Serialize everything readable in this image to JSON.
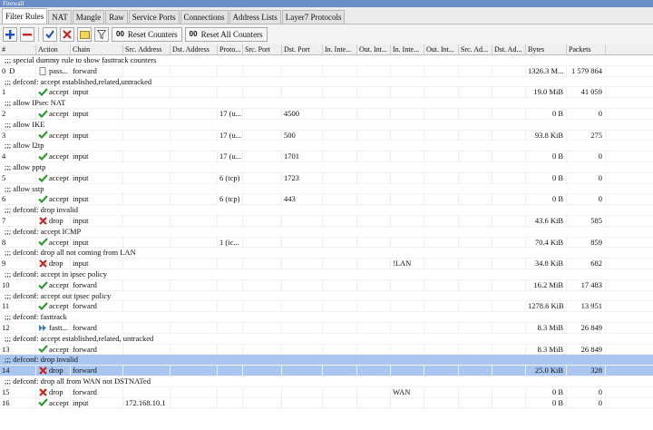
{
  "window": {
    "title": "Firewall"
  },
  "tabs": [
    "Filter Rules",
    "NAT",
    "Mangle",
    "Raw",
    "Service Ports",
    "Connections",
    "Address Lists",
    "Layer7 Protocols"
  ],
  "toolbar": {
    "add_icon": "plus-icon",
    "remove_icon": "minus-icon",
    "enable_icon": "check-icon",
    "disable_icon": "x-icon",
    "comment_icon": "note-icon",
    "filter_icon": "filter-icon",
    "reset_counters": "Reset Counters",
    "reset_all_counters": "Reset All Counters",
    "counter_glyph": "00"
  },
  "columns": [
    "#",
    "Action",
    "Chain",
    "Src. Address",
    "Dst. Address",
    "Proto...",
    "Src. Port",
    "Dst. Port",
    "In. Inte...",
    "Out. Int...",
    "In. Inte...",
    "Out. Int...",
    "Src. Ad...",
    "Dst. Ad...",
    "Bytes",
    "Packets"
  ],
  "colors": {
    "accept": "#2f9a2f",
    "drop": "#cc2222",
    "selected": "#a9c6f0",
    "passthrough": "#3a80c8"
  },
  "rules": [
    {
      "comment": ";;; special dummy rule to show fasttrack counters",
      "num": "0",
      "flag": "D",
      "action": "pass...",
      "action_type": "passthrough",
      "chain": "forward",
      "src": "",
      "dst": "",
      "proto": "",
      "sport": "",
      "dport": "",
      "inif": "",
      "outif": "",
      "inifl": "",
      "outifl": "",
      "srcal": "",
      "dstal": "",
      "bytes": "1326.3 M...",
      "packets": "1 579 864",
      "selected": false
    },
    {
      "comment": ";;; defconf: accept established,related,untracked",
      "num": "1",
      "flag": "",
      "action": "accept",
      "action_type": "accept",
      "chain": "input",
      "src": "",
      "dst": "",
      "proto": "",
      "sport": "",
      "dport": "",
      "inif": "",
      "outif": "",
      "inifl": "",
      "outifl": "",
      "srcal": "",
      "dstal": "",
      "bytes": "19.0 MiB",
      "packets": "41 059",
      "selected": false
    },
    {
      "comment": ";;; allow IPsec NAT",
      "num": "2",
      "flag": "",
      "action": "accept",
      "action_type": "accept",
      "chain": "input",
      "src": "",
      "dst": "",
      "proto": "17 (u...",
      "sport": "",
      "dport": "4500",
      "inif": "",
      "outif": "",
      "inifl": "",
      "outifl": "",
      "srcal": "",
      "dstal": "",
      "bytes": "0 B",
      "packets": "0",
      "selected": false
    },
    {
      "comment": ";;; allow IKE",
      "num": "3",
      "flag": "",
      "action": "accept",
      "action_type": "accept",
      "chain": "input",
      "src": "",
      "dst": "",
      "proto": "17 (u...",
      "sport": "",
      "dport": "500",
      "inif": "",
      "outif": "",
      "inifl": "",
      "outifl": "",
      "srcal": "",
      "dstal": "",
      "bytes": "93.8 KiB",
      "packets": "275",
      "selected": false
    },
    {
      "comment": ";;; allow l2tp",
      "num": "4",
      "flag": "",
      "action": "accept",
      "action_type": "accept",
      "chain": "input",
      "src": "",
      "dst": "",
      "proto": "17 (u...",
      "sport": "",
      "dport": "1701",
      "inif": "",
      "outif": "",
      "inifl": "",
      "outifl": "",
      "srcal": "",
      "dstal": "",
      "bytes": "0 B",
      "packets": "0",
      "selected": false
    },
    {
      "comment": ";;; allow pptp",
      "num": "5",
      "flag": "",
      "action": "accept",
      "action_type": "accept",
      "chain": "input",
      "src": "",
      "dst": "",
      "proto": "6 (tcp)",
      "sport": "",
      "dport": "1723",
      "inif": "",
      "outif": "",
      "inifl": "",
      "outifl": "",
      "srcal": "",
      "dstal": "",
      "bytes": "0 B",
      "packets": "0",
      "selected": false
    },
    {
      "comment": ";;; allow sstp",
      "num": "6",
      "flag": "",
      "action": "accept",
      "action_type": "accept",
      "chain": "input",
      "src": "",
      "dst": "",
      "proto": "6 (tcp)",
      "sport": "",
      "dport": "443",
      "inif": "",
      "outif": "",
      "inifl": "",
      "outifl": "",
      "srcal": "",
      "dstal": "",
      "bytes": "0 B",
      "packets": "0",
      "selected": false
    },
    {
      "comment": ";;; defconf: drop invalid",
      "num": "7",
      "flag": "",
      "action": "drop",
      "action_type": "drop",
      "chain": "input",
      "src": "",
      "dst": "",
      "proto": "",
      "sport": "",
      "dport": "",
      "inif": "",
      "outif": "",
      "inifl": "",
      "outifl": "",
      "srcal": "",
      "dstal": "",
      "bytes": "43.6 KiB",
      "packets": "585",
      "selected": false
    },
    {
      "comment": ";;; defconf: accept ICMP",
      "num": "8",
      "flag": "",
      "action": "accept",
      "action_type": "accept",
      "chain": "input",
      "src": "",
      "dst": "",
      "proto": "1 (ic...",
      "sport": "",
      "dport": "",
      "inif": "",
      "outif": "",
      "inifl": "",
      "outifl": "",
      "srcal": "",
      "dstal": "",
      "bytes": "70.4 KiB",
      "packets": "859",
      "selected": false
    },
    {
      "comment": ";;; defconf: drop all not coming from LAN",
      "num": "9",
      "flag": "",
      "action": "drop",
      "action_type": "drop",
      "chain": "input",
      "src": "",
      "dst": "",
      "proto": "",
      "sport": "",
      "dport": "",
      "inif": "",
      "outif": "",
      "inifl": "!LAN",
      "outifl": "",
      "srcal": "",
      "dstal": "",
      "bytes": "34.8 KiB",
      "packets": "682",
      "selected": false
    },
    {
      "comment": ";;; defconf: accept in ipsec policy",
      "num": "10",
      "flag": "",
      "action": "accept",
      "action_type": "accept",
      "chain": "forward",
      "src": "",
      "dst": "",
      "proto": "",
      "sport": "",
      "dport": "",
      "inif": "",
      "outif": "",
      "inifl": "",
      "outifl": "",
      "srcal": "",
      "dstal": "",
      "bytes": "16.2 MiB",
      "packets": "17 483",
      "selected": false
    },
    {
      "comment": ";;; defconf: accept out ipsec policy",
      "num": "11",
      "flag": "",
      "action": "accept",
      "action_type": "accept",
      "chain": "forward",
      "src": "",
      "dst": "",
      "proto": "",
      "sport": "",
      "dport": "",
      "inif": "",
      "outif": "",
      "inifl": "",
      "outifl": "",
      "srcal": "",
      "dstal": "",
      "bytes": "1278.6 KiB",
      "packets": "13 951",
      "selected": false
    },
    {
      "comment": ";;; defconf: fasttrack",
      "num": "12",
      "flag": "",
      "action": "fastt...",
      "action_type": "fasttrack",
      "chain": "forward",
      "src": "",
      "dst": "",
      "proto": "",
      "sport": "",
      "dport": "",
      "inif": "",
      "outif": "",
      "inifl": "",
      "outifl": "",
      "srcal": "",
      "dstal": "",
      "bytes": "8.3 MiB",
      "packets": "26 849",
      "selected": false
    },
    {
      "comment": ";;; defconf: accept established,related, untracked",
      "num": "13",
      "flag": "",
      "action": "accept",
      "action_type": "accept",
      "chain": "forward",
      "src": "",
      "dst": "",
      "proto": "",
      "sport": "",
      "dport": "",
      "inif": "",
      "outif": "",
      "inifl": "",
      "outifl": "",
      "srcal": "",
      "dstal": "",
      "bytes": "8.3 MiB",
      "packets": "26 849",
      "selected": false
    },
    {
      "comment": ";;; defconf: drop invalid",
      "num": "14",
      "flag": "",
      "action": "drop",
      "action_type": "drop",
      "chain": "forward",
      "src": "",
      "dst": "",
      "proto": "",
      "sport": "",
      "dport": "",
      "inif": "",
      "outif": "",
      "inifl": "",
      "outifl": "",
      "srcal": "",
      "dstal": "",
      "bytes": "25.0 KiB",
      "packets": "328",
      "selected": true
    },
    {
      "comment": ";;; defconf: drop all from WAN not DSTNATed",
      "num": "15",
      "flag": "",
      "action": "drop",
      "action_type": "drop",
      "chain": "forward",
      "src": "",
      "dst": "",
      "proto": "",
      "sport": "",
      "dport": "",
      "inif": "",
      "outif": "",
      "inifl": "WAN",
      "outifl": "",
      "srcal": "",
      "dstal": "",
      "bytes": "0 B",
      "packets": "0",
      "selected": false
    },
    {
      "comment": "",
      "num": "16",
      "flag": "",
      "action": "accept",
      "action_type": "accept",
      "chain": "input",
      "src": "172.168.10.1",
      "dst": "",
      "proto": "",
      "sport": "",
      "dport": "",
      "inif": "",
      "outif": "",
      "inifl": "",
      "outifl": "",
      "srcal": "",
      "dstal": "",
      "bytes": "0 B",
      "packets": "0",
      "selected": false
    }
  ]
}
